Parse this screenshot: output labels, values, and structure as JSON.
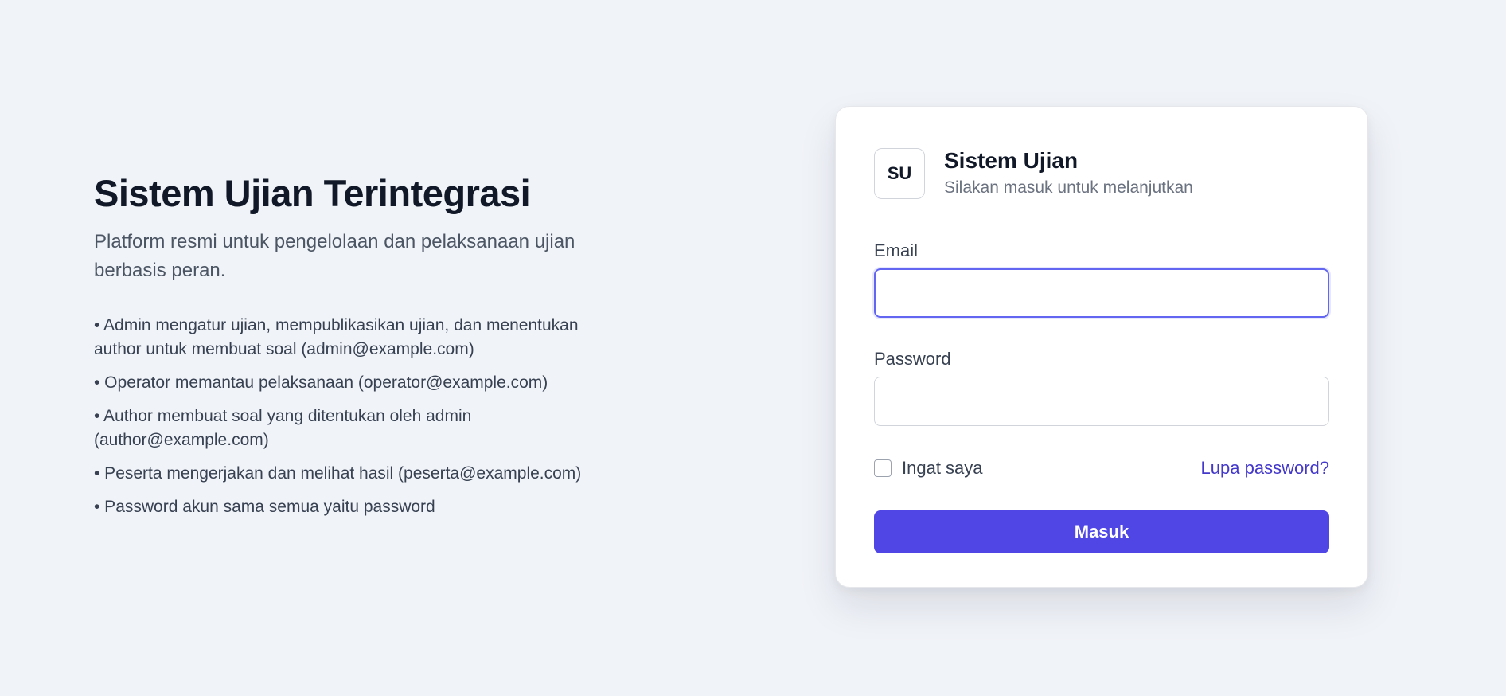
{
  "intro": {
    "title": "Sistem Ujian Terintegrasi",
    "subtitle": "Platform resmi untuk pengelolaan dan pelaksanaan ujian berbasis peran.",
    "bullets": [
      "• Admin mengatur ujian, mempublikasikan ujian, dan menentukan author untuk membuat soal (admin@example.com)",
      "• Operator memantau pelaksanaan (operator@example.com)",
      "• Author membuat soal yang ditentukan oleh admin (author@example.com)",
      "• Peserta mengerjakan dan melihat hasil (peserta@example.com)",
      "• Password akun sama semua yaitu password"
    ]
  },
  "login": {
    "logo_text": "SU",
    "title": "Sistem Ujian",
    "subtitle": "Silakan masuk untuk melanjutkan",
    "email_label": "Email",
    "email_value": "",
    "password_label": "Password",
    "password_value": "",
    "remember_label": "Ingat saya",
    "remember_checked": false,
    "forgot_label": "Lupa password?",
    "submit_label": "Masuk"
  },
  "colors": {
    "background": "#f0f3f8",
    "accent": "#4f46e5",
    "link": "#4338ca",
    "focus_border": "#6366f1"
  }
}
